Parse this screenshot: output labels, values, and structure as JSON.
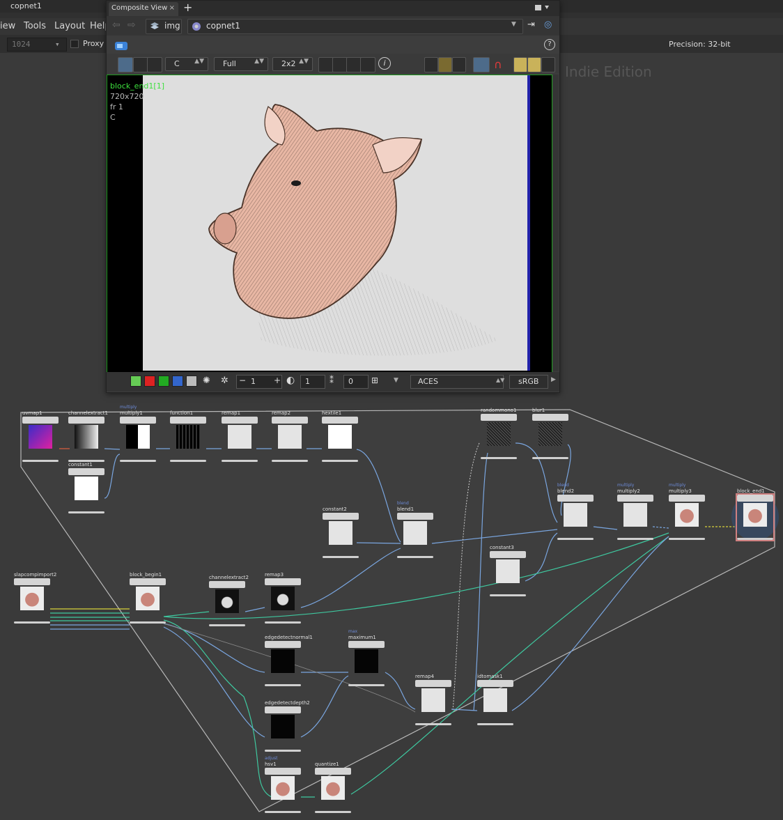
{
  "window": {
    "title": "copnet1"
  },
  "menu": {
    "items": [
      "iew",
      "Tools",
      "Layout",
      "Help"
    ]
  },
  "toolbar": {
    "frame_value": "1024",
    "proxy_label": "Proxy 1",
    "precision_label": "Precision: 32-bit"
  },
  "watermark": "Indie Edition",
  "composite_view": {
    "tab_label": "Composite View",
    "close_glyph": "×",
    "add_glyph": "+",
    "path": {
      "context": "img",
      "network": "copnet1"
    },
    "view_controls": {
      "channel": "C",
      "resolution": "Full",
      "layout": "2x2"
    },
    "overlay": {
      "node_name": "block_end1[1]",
      "resolution": "720x720",
      "frame": "fr 1",
      "channel": "C"
    },
    "bottom": {
      "exposure_value": "1",
      "gamma_value": "1",
      "offset_value": "0",
      "ocio": "ACES",
      "display": "sRGB"
    }
  },
  "network": {
    "nodes": [
      {
        "name": "uvmap1",
        "type": ""
      },
      {
        "name": "channelextract1",
        "type": ""
      },
      {
        "name": "multiply1",
        "type": "multiply"
      },
      {
        "name": "function1",
        "type": ""
      },
      {
        "name": "remap1",
        "type": ""
      },
      {
        "name": "remap2",
        "type": ""
      },
      {
        "name": "hextile1",
        "type": ""
      },
      {
        "name": "randommono1",
        "type": ""
      },
      {
        "name": "blur1",
        "type": ""
      },
      {
        "name": "constant1",
        "type": ""
      },
      {
        "name": "constant2",
        "type": ""
      },
      {
        "name": "blend1",
        "type": "blend"
      },
      {
        "name": "blend2",
        "type": "blend"
      },
      {
        "name": "multiply2",
        "type": "multiply"
      },
      {
        "name": "multiply3",
        "type": "multiply"
      },
      {
        "name": "block_end1",
        "type": ""
      },
      {
        "name": "constant3",
        "type": ""
      },
      {
        "name": "slapcompimport2",
        "type": ""
      },
      {
        "name": "block_begin1",
        "type": ""
      },
      {
        "name": "channelextract2",
        "type": ""
      },
      {
        "name": "remap3",
        "type": ""
      },
      {
        "name": "edgedetectnormal1",
        "type": ""
      },
      {
        "name": "maximum1",
        "type": "max"
      },
      {
        "name": "remap4",
        "type": ""
      },
      {
        "name": "idtomask1",
        "type": ""
      },
      {
        "name": "edgedetectdepth2",
        "type": ""
      },
      {
        "name": "hsv1",
        "type": "adjust"
      },
      {
        "name": "quantize1",
        "type": ""
      }
    ]
  },
  "colors": {
    "selected_viewport_border": "#1e9a1e",
    "overlay_node_name": "#3ee03e",
    "wire_blue": "#7aa6e0",
    "wire_green": "#3ec9a0",
    "wire_yellow": "#d8d23a"
  },
  "icons": [
    "composite-view-icon",
    "back-icon",
    "forward-icon",
    "pin-icon",
    "help-icon",
    "info-icon",
    "zoom-in-icon",
    "zoom-out-icon",
    "home-icon",
    "magnet-icon"
  ]
}
